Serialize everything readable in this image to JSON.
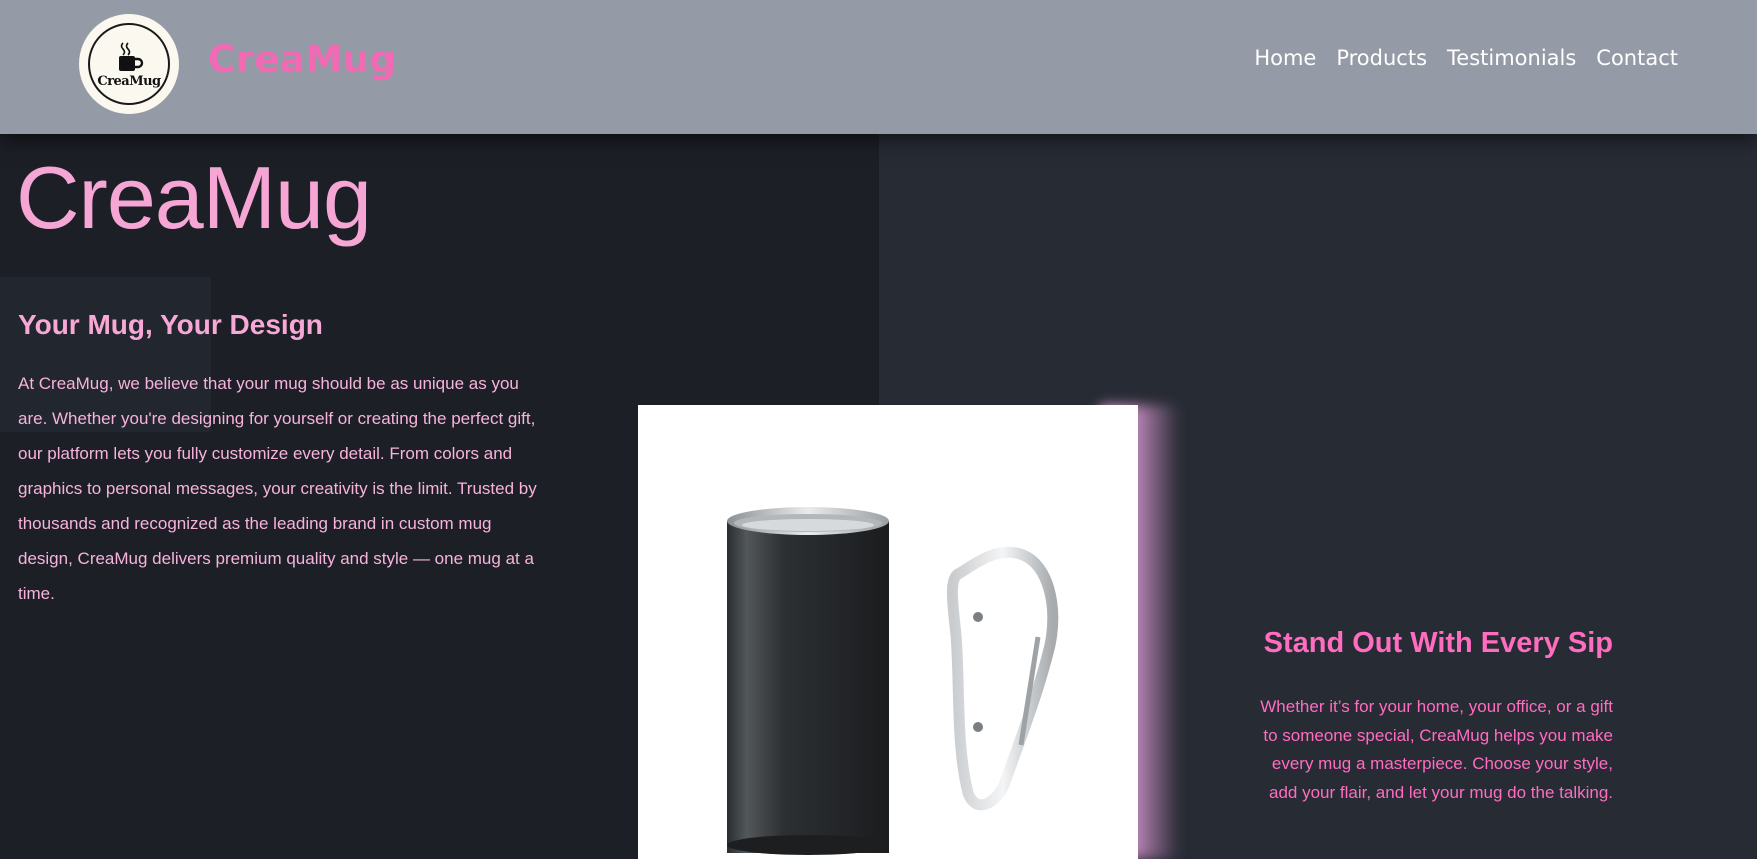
{
  "header": {
    "logo_text": "CreaMug",
    "brand": "CreaMug",
    "nav": [
      "Home",
      "Products",
      "Testimonials",
      "Contact"
    ]
  },
  "hero": {
    "title": "CreaMug",
    "tagline": "Your Mug, Your Design",
    "intro": "At CreaMug, we believe that your mug should be as unique as you are. Whether you're designing for yourself or creating the perfect gift, our platform lets you fully customize every detail. From colors and graphics to personal messages, your creativity is the limit. Trusted by thousands and recognized as the leading brand in custom mug design, CreaMug delivers premium quality and style — one mug at a time."
  },
  "feature": {
    "title": "Stand Out With Every Sip",
    "text": "Whether it’s for your home, your office, or a gift to someone special, CreaMug helps you make every mug a masterpiece. Choose your style, add your flair, and let your mug do the talking."
  },
  "colors": {
    "header_bg": "#949ba6",
    "brand_pink": "#f06ab4",
    "text_pink": "#f7b3dc",
    "accent_pink": "#ff6cc0",
    "page_bg": "#1c1f26",
    "panel_bg": "#272b34"
  },
  "icons": {
    "logo": "coffee-cup-icon",
    "product": "black-carabiner-mug-image"
  }
}
